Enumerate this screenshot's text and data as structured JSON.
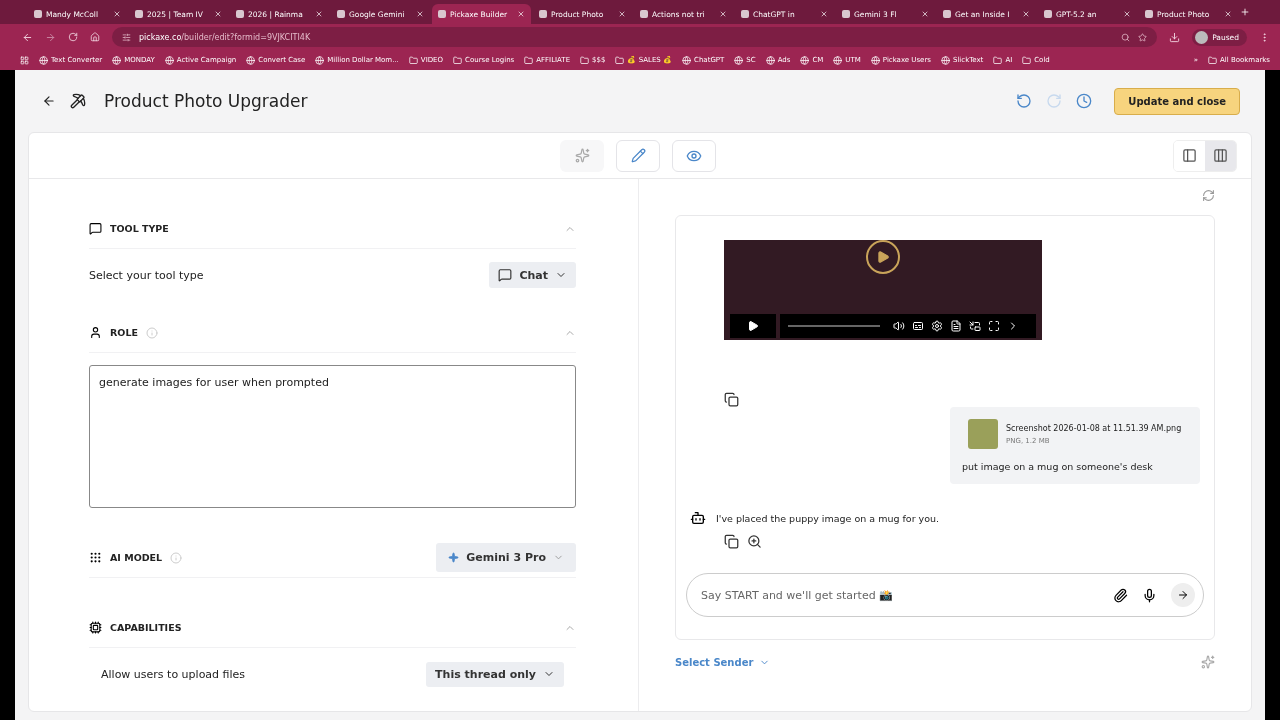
{
  "browser": {
    "tabs": [
      {
        "label": "Mandy McColl",
        "selected": false
      },
      {
        "label": "2025 | Team IV",
        "selected": false
      },
      {
        "label": "2026 | Rainma",
        "selected": false
      },
      {
        "label": "Google Gemini",
        "selected": false
      },
      {
        "label": "Pickaxe Builder",
        "selected": true
      },
      {
        "label": "Product Photo",
        "selected": false
      },
      {
        "label": "Actions not tri",
        "selected": false
      },
      {
        "label": "ChatGPT in",
        "selected": false
      },
      {
        "label": "Gemini 3 Fl",
        "selected": false
      },
      {
        "label": "Get an Inside I",
        "selected": false
      },
      {
        "label": "GPT-5.2 an",
        "selected": false
      },
      {
        "label": "Product Photo",
        "selected": false
      }
    ],
    "url_host": "pickaxe.co",
    "url_path": "/builder/edit?formid=9VJKCITI4K",
    "profile_status": "Paused",
    "bookmarks": [
      {
        "label": "Text Converter",
        "kind": "site"
      },
      {
        "label": "MONDAY",
        "kind": "site"
      },
      {
        "label": "Active Campaign",
        "kind": "site"
      },
      {
        "label": "Convert Case",
        "kind": "site"
      },
      {
        "label": "Million Dollar Mom...",
        "kind": "site"
      },
      {
        "label": "VIDEO",
        "kind": "folder"
      },
      {
        "label": "Course Logins",
        "kind": "folder"
      },
      {
        "label": "AFFILIATE",
        "kind": "folder"
      },
      {
        "label": "$$$",
        "kind": "folder"
      },
      {
        "label": "💰 SALES 💰",
        "kind": "folder"
      },
      {
        "label": "ChatGPT",
        "kind": "site"
      },
      {
        "label": "SC",
        "kind": "site"
      },
      {
        "label": "Ads",
        "kind": "site"
      },
      {
        "label": "CM",
        "kind": "site"
      },
      {
        "label": "UTM",
        "kind": "site"
      },
      {
        "label": "Pickaxe Users",
        "kind": "site"
      },
      {
        "label": "SlickText",
        "kind": "site"
      },
      {
        "label": "AI",
        "kind": "folder"
      },
      {
        "label": "Cold",
        "kind": "folder"
      }
    ],
    "overflow": "»",
    "all_bookmarks": "All Bookmarks"
  },
  "header": {
    "title": "Product Photo Upgrader",
    "redo_disabled": true,
    "update_button": "Update and close"
  },
  "layout_options": [
    {
      "kind": "single",
      "selected": false
    },
    {
      "kind": "split",
      "selected": true
    }
  ],
  "sections": [
    {
      "kind": "select",
      "title": "TOOL TYPE",
      "label": "Select your tool type",
      "value": "Chat",
      "info": false,
      "collapsible": true
    },
    {
      "kind": "text",
      "title": "ROLE",
      "value": "generate images for user when prompted",
      "info": true,
      "collapsible": true
    },
    {
      "kind": "model",
      "title": "AI MODEL",
      "value": "Gemini 3 Pro",
      "info": true,
      "collapsible": false
    },
    {
      "kind": "select",
      "title": "CAPABILITIES",
      "label": "Allow users to upload files",
      "value": "This thread only",
      "info": false,
      "collapsible": true
    }
  ],
  "chat": {
    "attachment": {
      "name": "Screenshot 2026-01-08 at 11.51.39 AM.png",
      "meta": "PNG, 1.2 MB"
    },
    "user_message": "put image on a mug on someone's desk",
    "bot_message": "I've placed the puppy image on a mug for you.",
    "input_placeholder": "Say START and we'll get started 📸",
    "select_sender": "Select Sender"
  }
}
